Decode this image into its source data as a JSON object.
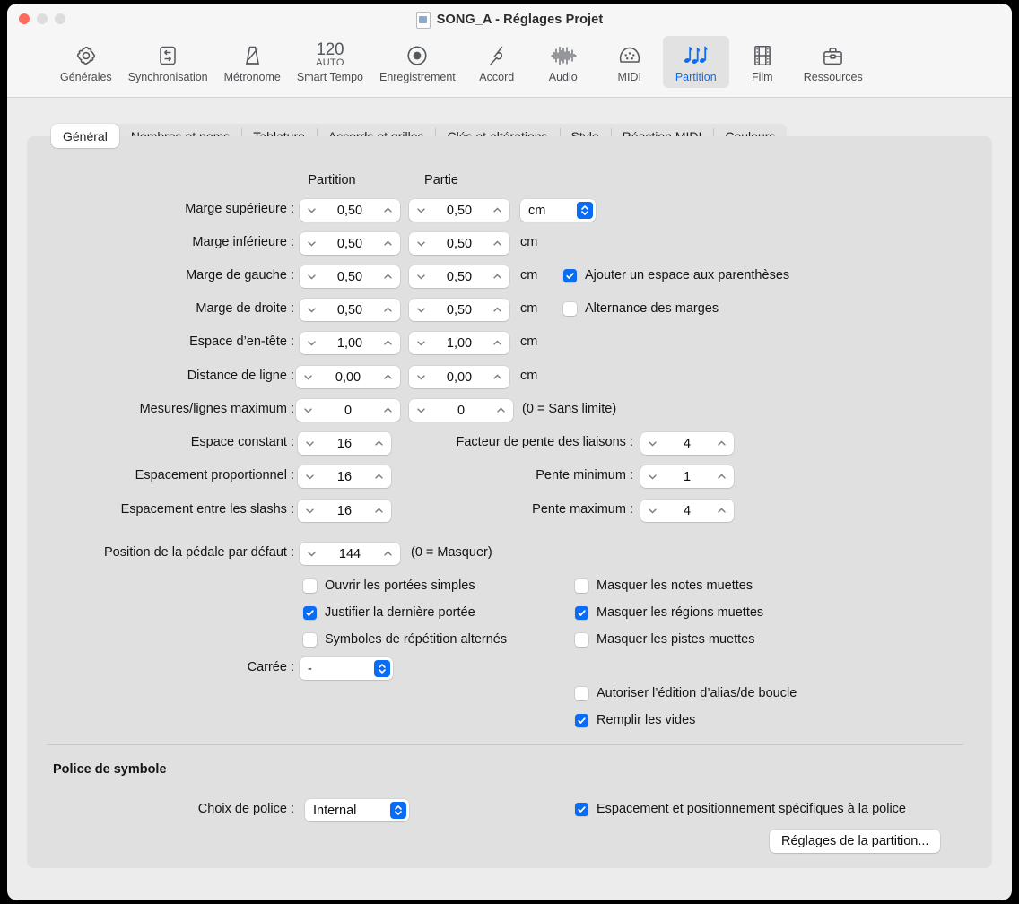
{
  "window": {
    "title": "SONG_A - Réglages Projet",
    "doc_icon": "document-icon",
    "traffic": {
      "close": "close-button",
      "minimize": "minimize-button",
      "zoom": "zoom-button"
    }
  },
  "toolbar": {
    "items": [
      {
        "label": "Générales",
        "icon": "gear-icon",
        "active": false
      },
      {
        "label": "Synchronisation",
        "icon": "sync-icon",
        "active": false
      },
      {
        "label": "Métronome",
        "icon": "metronome-icon",
        "active": false
      },
      {
        "label": "Smart Tempo",
        "icon": "tempo-icon",
        "active": false,
        "tempo_value": "120",
        "tempo_mode": "AUTO"
      },
      {
        "label": "Enregistrement",
        "icon": "record-icon",
        "active": false
      },
      {
        "label": "Accord",
        "icon": "tuning-fork-icon",
        "active": false
      },
      {
        "label": "Audio",
        "icon": "waveform-icon",
        "active": false
      },
      {
        "label": "MIDI",
        "icon": "midi-icon",
        "active": false
      },
      {
        "label": "Partition",
        "icon": "score-notes-icon",
        "active": true
      },
      {
        "label": "Film",
        "icon": "film-icon",
        "active": false
      },
      {
        "label": "Ressources",
        "icon": "briefcase-icon",
        "active": false
      }
    ]
  },
  "tabs": [
    {
      "label": "Général",
      "active": true
    },
    {
      "label": "Nombres et noms",
      "active": false
    },
    {
      "label": "Tablature",
      "active": false
    },
    {
      "label": "Accords et grilles",
      "active": false
    },
    {
      "label": "Clés et altérations",
      "active": false
    },
    {
      "label": "Style",
      "active": false
    },
    {
      "label": "Réaction MIDI",
      "active": false
    },
    {
      "label": "Couleurs",
      "active": false
    }
  ],
  "columns": {
    "score": "Partition",
    "part": "Partie"
  },
  "margins": [
    {
      "label": "Marge supérieure :",
      "score": "0,50",
      "part": "0,50",
      "unit": "cm"
    },
    {
      "label": "Marge inférieure :",
      "score": "0,50",
      "part": "0,50",
      "unit": "cm"
    },
    {
      "label": "Marge de gauche :",
      "score": "0,50",
      "part": "0,50",
      "unit": "cm"
    },
    {
      "label": "Marge de droite :",
      "score": "0,50",
      "part": "0,50",
      "unit": "cm"
    },
    {
      "label": "Espace d’en-tête :",
      "score": "1,00",
      "part": "1,00",
      "unit": "cm"
    },
    {
      "label": "Distance de ligne :",
      "score": "0,00",
      "part": "0,00",
      "unit": "cm"
    },
    {
      "label": "Mesures/lignes maximum :",
      "score": "0",
      "part": "0",
      "unit": "(0 = Sans limite)"
    }
  ],
  "unit_popup": {
    "value": "cm"
  },
  "margin_checkboxes": [
    {
      "label": "Ajouter un espace aux parenthèses",
      "checked": true
    },
    {
      "label": "Alternance des marges",
      "checked": false
    }
  ],
  "spacing_left": [
    {
      "label": "Espace constant :",
      "value": "16"
    },
    {
      "label": "Espacement proportionnel :",
      "value": "16"
    },
    {
      "label": "Espacement entre les slashs :",
      "value": "16"
    }
  ],
  "spacing_right": [
    {
      "label": "Facteur de pente des liaisons :",
      "value": "4"
    },
    {
      "label": "Pente minimum :",
      "value": "1"
    },
    {
      "label": "Pente maximum :",
      "value": "4"
    }
  ],
  "pedal": {
    "label": "Position de la pédale par défaut :",
    "value": "144",
    "hint": "(0 = Masquer)"
  },
  "options_left": [
    {
      "label": "Ouvrir les portées simples",
      "checked": false
    },
    {
      "label": "Justifier la dernière portée",
      "checked": true
    },
    {
      "label": "Symboles de répétition alternés",
      "checked": false
    }
  ],
  "options_right": [
    {
      "label": "Masquer les notes muettes",
      "checked": false
    },
    {
      "label": "Masquer les régions muettes",
      "checked": true
    },
    {
      "label": "Masquer les pistes muettes",
      "checked": false
    }
  ],
  "options_right2": [
    {
      "label": "Autoriser l’édition d’alias/de boucle",
      "checked": false
    },
    {
      "label": "Remplir les vides",
      "checked": true
    }
  ],
  "breve": {
    "label": "Carrée :",
    "value": "-"
  },
  "symbol_font": {
    "section_title": "Police de symbole",
    "choice_label": "Choix de police :",
    "choice_value": "Internal",
    "spacing_checkbox": {
      "label": "Espacement et positionnement spécifiques à la police",
      "checked": true
    },
    "button": "Réglages de la partition..."
  },
  "colors": {
    "accent": "#0a6cf5",
    "window_bg": "#ececec",
    "panel_bg": "#e0e0e0",
    "close": "#ff6a5f"
  }
}
